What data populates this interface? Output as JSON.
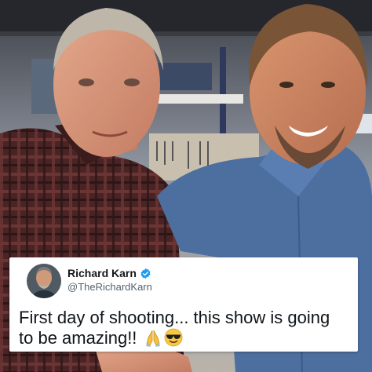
{
  "tweet": {
    "display_name": "Richard Karn",
    "handle": "@TheRichardKarn",
    "verified": true,
    "text": "First day of shooting... this show is going to be amazing!!",
    "emojis": [
      "folded-hands-emoji",
      "smiling-face-with-sunglasses-emoji"
    ]
  },
  "icons": {
    "verified": "verified-badge-icon"
  },
  "colors": {
    "verified_blue": "#1d9bf0",
    "name_text": "#14171a",
    "handle_text": "#536471",
    "card_bg": "#ffffff"
  }
}
